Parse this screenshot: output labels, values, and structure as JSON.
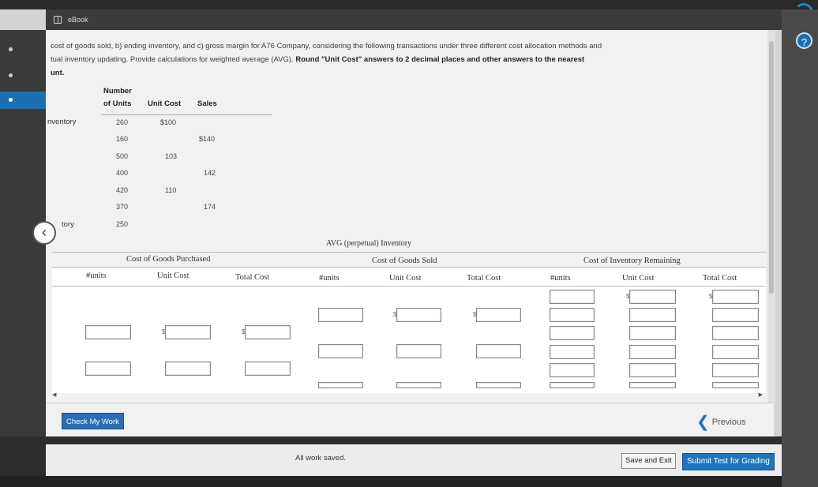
{
  "header": {
    "title": "eBook"
  },
  "question": {
    "line1": "cost of goods sold, b) ending inventory, and c) gross margin for A76 Company, considering the following transactions under three different cost allocation methods and",
    "line2_a": "tual inventory updating. Provide calculations for weighted average (AVG). ",
    "line2_b": "Round \"Unit Cost\" answers to 2 decimal places and other answers to the nearest",
    "line3": "unt."
  },
  "purchase_table": {
    "headers": {
      "number": "Number",
      "of_units": "of Units",
      "unit_cost": "Unit Cost",
      "sales": "Sales"
    },
    "row_labels": {
      "inventory": "nventory",
      "ending": "tory"
    },
    "rows": [
      {
        "units": "260",
        "unit_cost": "$100",
        "sales": ""
      },
      {
        "units": "160",
        "unit_cost": "",
        "sales": "$140"
      },
      {
        "units": "500",
        "unit_cost": "103",
        "sales": ""
      },
      {
        "units": "400",
        "unit_cost": "",
        "sales": "142"
      },
      {
        "units": "420",
        "unit_cost": "110",
        "sales": ""
      },
      {
        "units": "370",
        "unit_cost": "",
        "sales": "174"
      },
      {
        "units": "250",
        "unit_cost": "",
        "sales": ""
      }
    ]
  },
  "avg_table": {
    "title": "AVG (perpetual) Inventory",
    "sections": {
      "purchased": "Cost of Goods Purchased",
      "sold": "Cost of Goods Sold",
      "remaining": "Cost of Inventory Remaining"
    },
    "columns": {
      "p_units": "#units",
      "p_unit_cost": "Unit Cost",
      "p_total": "Total Cost",
      "s_units": "#units",
      "s_unit_cost": "Unit Cost",
      "s_total": "Total Cost",
      "r_units": "#units",
      "r_unit_cost": "Unit Cost",
      "r_total": "Total Cost"
    },
    "currency": "$"
  },
  "buttons": {
    "check": "Check My Work",
    "previous": "Previous",
    "save_exit": "Save and Exit",
    "submit": "Submit Test for Grading"
  },
  "status": {
    "saved": "All work saved."
  },
  "help": {
    "label": "?"
  }
}
